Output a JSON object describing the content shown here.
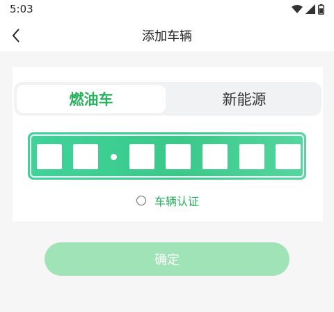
{
  "status_bar": {
    "time": "5:03",
    "icons": [
      "wifi-icon",
      "signal-icon",
      "battery-icon"
    ]
  },
  "header": {
    "back_icon": "back-arrow-icon",
    "title": "添加车辆"
  },
  "tabs": [
    {
      "label": "燃油车",
      "active": true
    },
    {
      "label": "新能源",
      "active": false
    }
  ],
  "plate": {
    "slots": 7,
    "values": [
      "",
      "",
      "",
      "",
      "",
      "",
      ""
    ]
  },
  "certification": {
    "label": "车辆认证",
    "checked": false
  },
  "confirm": {
    "label": "确定",
    "enabled": false
  },
  "colors": {
    "accent": "#27b25c",
    "plate_green": "#3bc98a",
    "button_disabled": "#9fe3b6"
  }
}
